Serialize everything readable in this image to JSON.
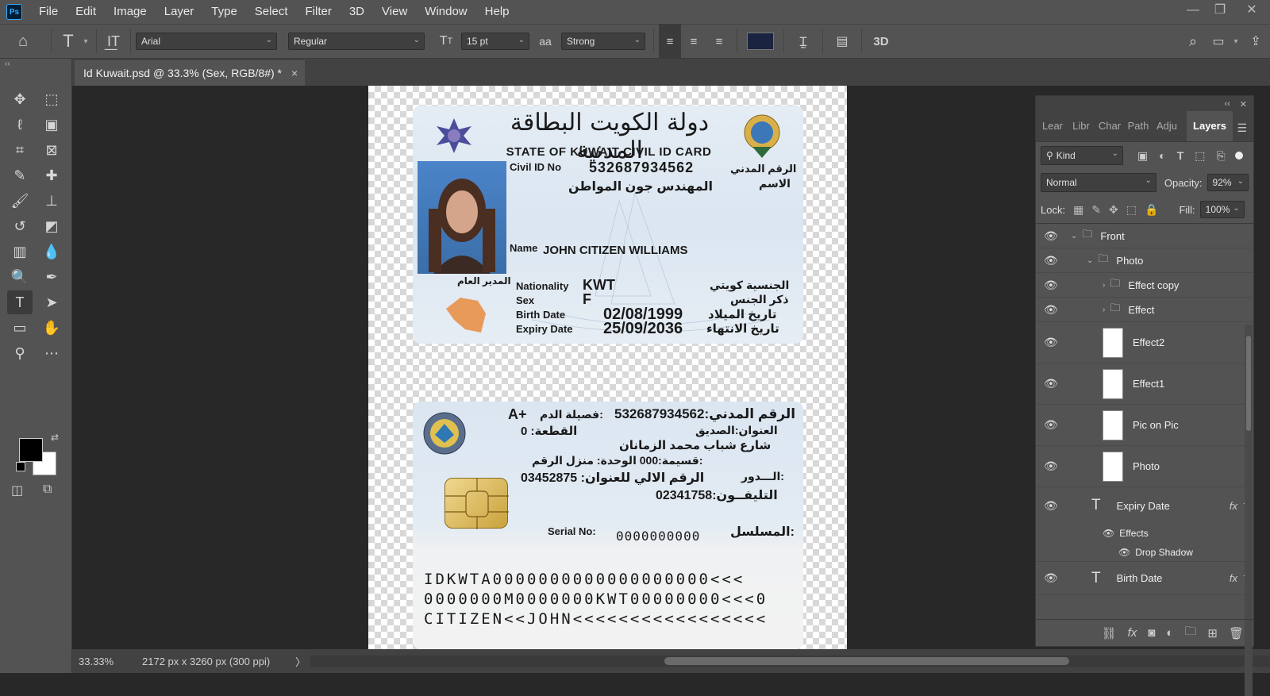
{
  "app": {
    "logo": "Ps",
    "menu": [
      "File",
      "Edit",
      "Image",
      "Layer",
      "Type",
      "Select",
      "Filter",
      "3D",
      "View",
      "Window",
      "Help"
    ],
    "window_controls": [
      "—",
      "❐",
      "✕"
    ]
  },
  "options": {
    "font_family": "Arial",
    "font_style": "Regular",
    "font_size": "15 pt",
    "antialias_icon": "aa",
    "antialias": "Strong",
    "color": "#1a2340",
    "three_d": "3D"
  },
  "document": {
    "tab_title": "Id Kuwait.psd @ 33.3% (Sex, RGB/8#) *",
    "close": "×"
  },
  "status": {
    "zoom": "33.33%",
    "doc_info": "2172 px x 3260 px (300 ppi)",
    "arrow": "〉"
  },
  "card_front": {
    "arabic_title": "دولة الكويت البطاقة المدنية",
    "english_title": "STATE OF KUWAIT CIVIL ID CARD",
    "civil_id_label": "Civil ID No",
    "civil_id": "532687934562",
    "civil_id_label_ar": "الرقم المدني",
    "name_ar": "المهندس جون المواطن",
    "name_label_ar": "الاسم",
    "name_label": "Name",
    "name": "JOHN CITIZEN WILLIAMS",
    "signature_ar": "المدير العام",
    "nationality_label": "Nationality",
    "nationality": "KWT",
    "nationality_ar": "الجنسية كويتي",
    "sex_label": "Sex",
    "sex": "F",
    "sex_ar": "ذكر الجنس",
    "birth_label": "Birth Date",
    "birth_date": "02/08/1999",
    "birth_ar": "تاريخ الميلاد",
    "expiry_label": "Expiry Date",
    "expiry_date": "25/09/2036",
    "expiry_ar": "تاريخ الانتهاء"
  },
  "card_back": {
    "civil_id_row": "532687934562:الرقم المدني",
    "blood_type": "A+",
    "blood_label_ar": "فصيلة الدم:",
    "address_ar": "العنوان:الصديق",
    "block": "القطعة: 0",
    "street_ar": "شارع شباب محمد الزمانان",
    "unit_ar": "قسيمة:000  الوحدة: منزل  الرقم:",
    "floor_ar": "الـــدور:",
    "auto_addr": "03452875 :الرقم الالي للعنوان",
    "phone": "02341758:التليفــون",
    "serial_label": "Serial No:",
    "serial": "0000000000",
    "serial_ar": "المسلسل:",
    "mrz": [
      "IDKWTA0000000000000000000<<<",
      "0000000M0000000KWT00000000<<<0",
      "CITIZEN<<JOHN<<<<<<<<<<<<<<<<<"
    ]
  },
  "layers_panel": {
    "tabs": [
      "Lear",
      "Libr",
      "Char",
      "Path",
      "Adju",
      "Layers"
    ],
    "filter": "Kind",
    "blend_mode": "Normal",
    "opacity_label": "Opacity:",
    "opacity": "92%",
    "lock_label": "Lock:",
    "fill_label": "Fill:",
    "fill": "100%",
    "layers": [
      {
        "name": "Front",
        "type": "group",
        "indent": 0,
        "expanded": true
      },
      {
        "name": "Photo",
        "type": "group",
        "indent": 1,
        "expanded": true
      },
      {
        "name": "Effect copy",
        "type": "group",
        "indent": 2,
        "expanded": false
      },
      {
        "name": "Effect",
        "type": "group",
        "indent": 2,
        "expanded": false
      },
      {
        "name": "Effect2",
        "type": "pixel",
        "indent": 2
      },
      {
        "name": "Effect1",
        "type": "pixel",
        "indent": 2
      },
      {
        "name": "Pic on Pic",
        "type": "pixel",
        "indent": 2
      },
      {
        "name": "Photo",
        "type": "pixel",
        "indent": 2
      },
      {
        "name": "Expiry Date",
        "type": "text",
        "indent": 1,
        "fx": true
      },
      {
        "name": "Effects",
        "type": "effects",
        "indent": 1
      },
      {
        "name": "Drop Shadow",
        "type": "effect",
        "indent": 1
      },
      {
        "name": "Birth Date",
        "type": "text",
        "indent": 1,
        "fx": true
      }
    ]
  }
}
